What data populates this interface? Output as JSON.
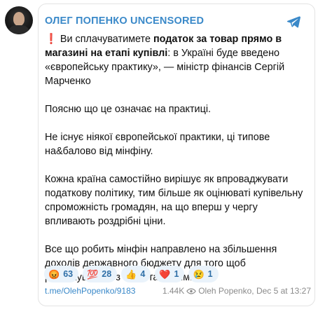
{
  "channel": {
    "name": "ОЛЕГ ПОПЕНКО UNCENSORED"
  },
  "post": {
    "p1_excl": "❗",
    "p1_a": " Ви сплачуватимете ",
    "p1_b": "податок за товар прямо в магазині на етапі купівлі",
    "p1_c": ": в Україні буде введено «європейську практику», — міністр фінансів Сергій Марченко",
    "p2": "Поясню що це означає на практиці.",
    "p3": "Не існує ніякої європейської практики, ці типове на&балово від мінфіну.",
    "p4": "Кожна країна самостійно вирішує як впроваджувати податкову політику, тим більше як оцінюваті купівельну спроможність громадян, на що вперш у чергу впливають роздрібні ціни.",
    "p5": "Все що робить мінфін направлено на збільшення доходів державного бюджету для того щоб розрахуватись з МВФ та іншими."
  },
  "reactions": [
    {
      "emoji": "😡",
      "count": "63"
    },
    {
      "emoji": "💯",
      "count": "28"
    },
    {
      "emoji": "👍",
      "count": "4"
    },
    {
      "emoji": "❤️",
      "count": "1"
    },
    {
      "emoji": "😢",
      "count": "1"
    }
  ],
  "footer": {
    "link": "t.me/OlehPopenko/9183",
    "views": "1.44K",
    "author_date": "Oleh Popenko, Dec 5 at 13:27"
  },
  "colors": {
    "accent": "#3a89c9",
    "reaction_bg": "#eaf3fb",
    "reaction_text": "#2f6fa7"
  },
  "icons": [
    "telegram-icon",
    "eye-icon"
  ]
}
